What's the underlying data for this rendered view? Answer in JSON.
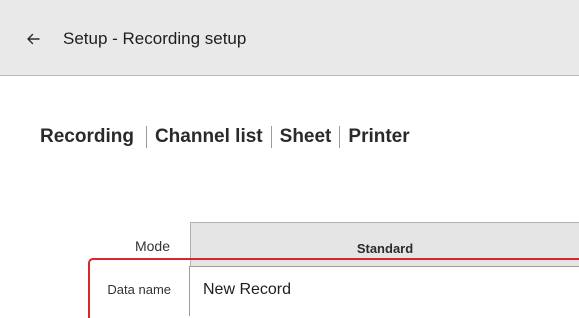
{
  "header": {
    "back_icon": "arrow-left-icon",
    "title": "Setup - Recording setup"
  },
  "tabs": [
    {
      "label": "Recording"
    },
    {
      "label": "Channel list"
    },
    {
      "label": "Sheet"
    },
    {
      "label": "Printer"
    }
  ],
  "form": {
    "mode": {
      "label": "Mode",
      "value": "Standard"
    },
    "data_name": {
      "label": "Data name",
      "value": "New Record"
    }
  },
  "colors": {
    "header_background": "#e9e9e9",
    "highlight_frame": "#d9262c",
    "mode_button_background": "#e5e5e5"
  }
}
